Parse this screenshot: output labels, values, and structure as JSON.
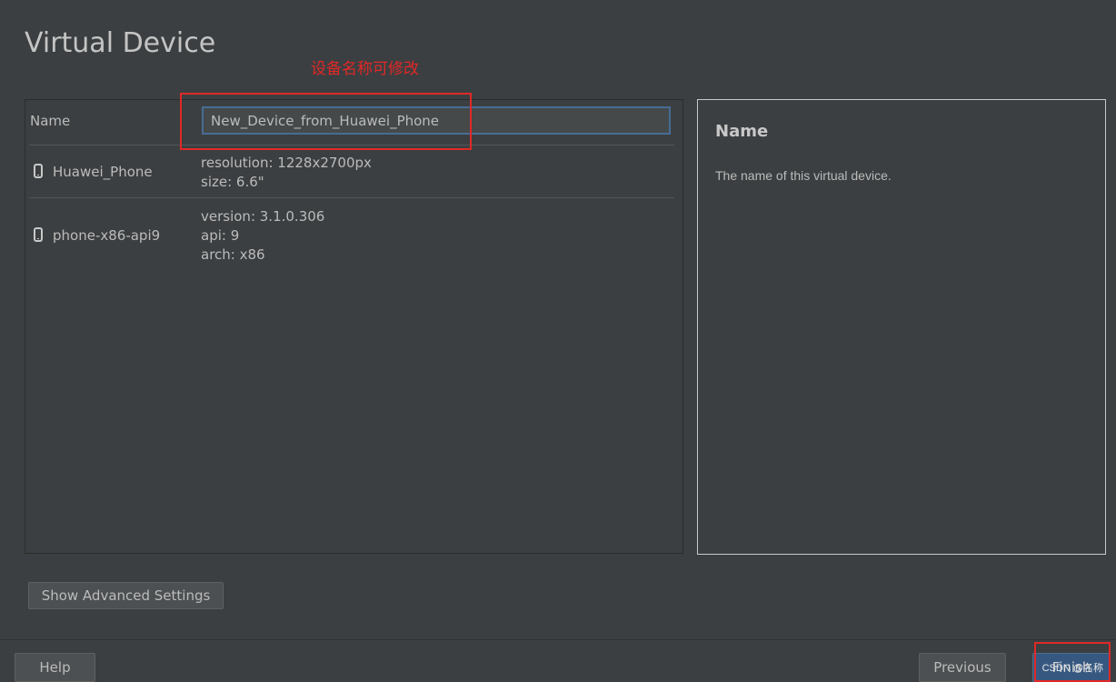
{
  "window": {
    "title": "Virtual Device"
  },
  "annotation": {
    "text": "设备名称可修改"
  },
  "form": {
    "name_label": "Name",
    "name_value": "New_Device_from_Huawei_Phone"
  },
  "devices": [
    {
      "name": "Huawei_Phone",
      "details": [
        "resolution: 1228x2700px",
        "size: 6.6\""
      ]
    },
    {
      "name": "phone-x86-api9",
      "details": [
        "version: 3.1.0.306",
        "api: 9",
        "arch: x86"
      ]
    }
  ],
  "help_panel": {
    "title": "Name",
    "text": "The name of this virtual device."
  },
  "buttons": {
    "advanced": "Show Advanced Settings",
    "help": "Help",
    "previous": "Previous",
    "finish": "Finish"
  },
  "watermark": "CSDN @名称"
}
